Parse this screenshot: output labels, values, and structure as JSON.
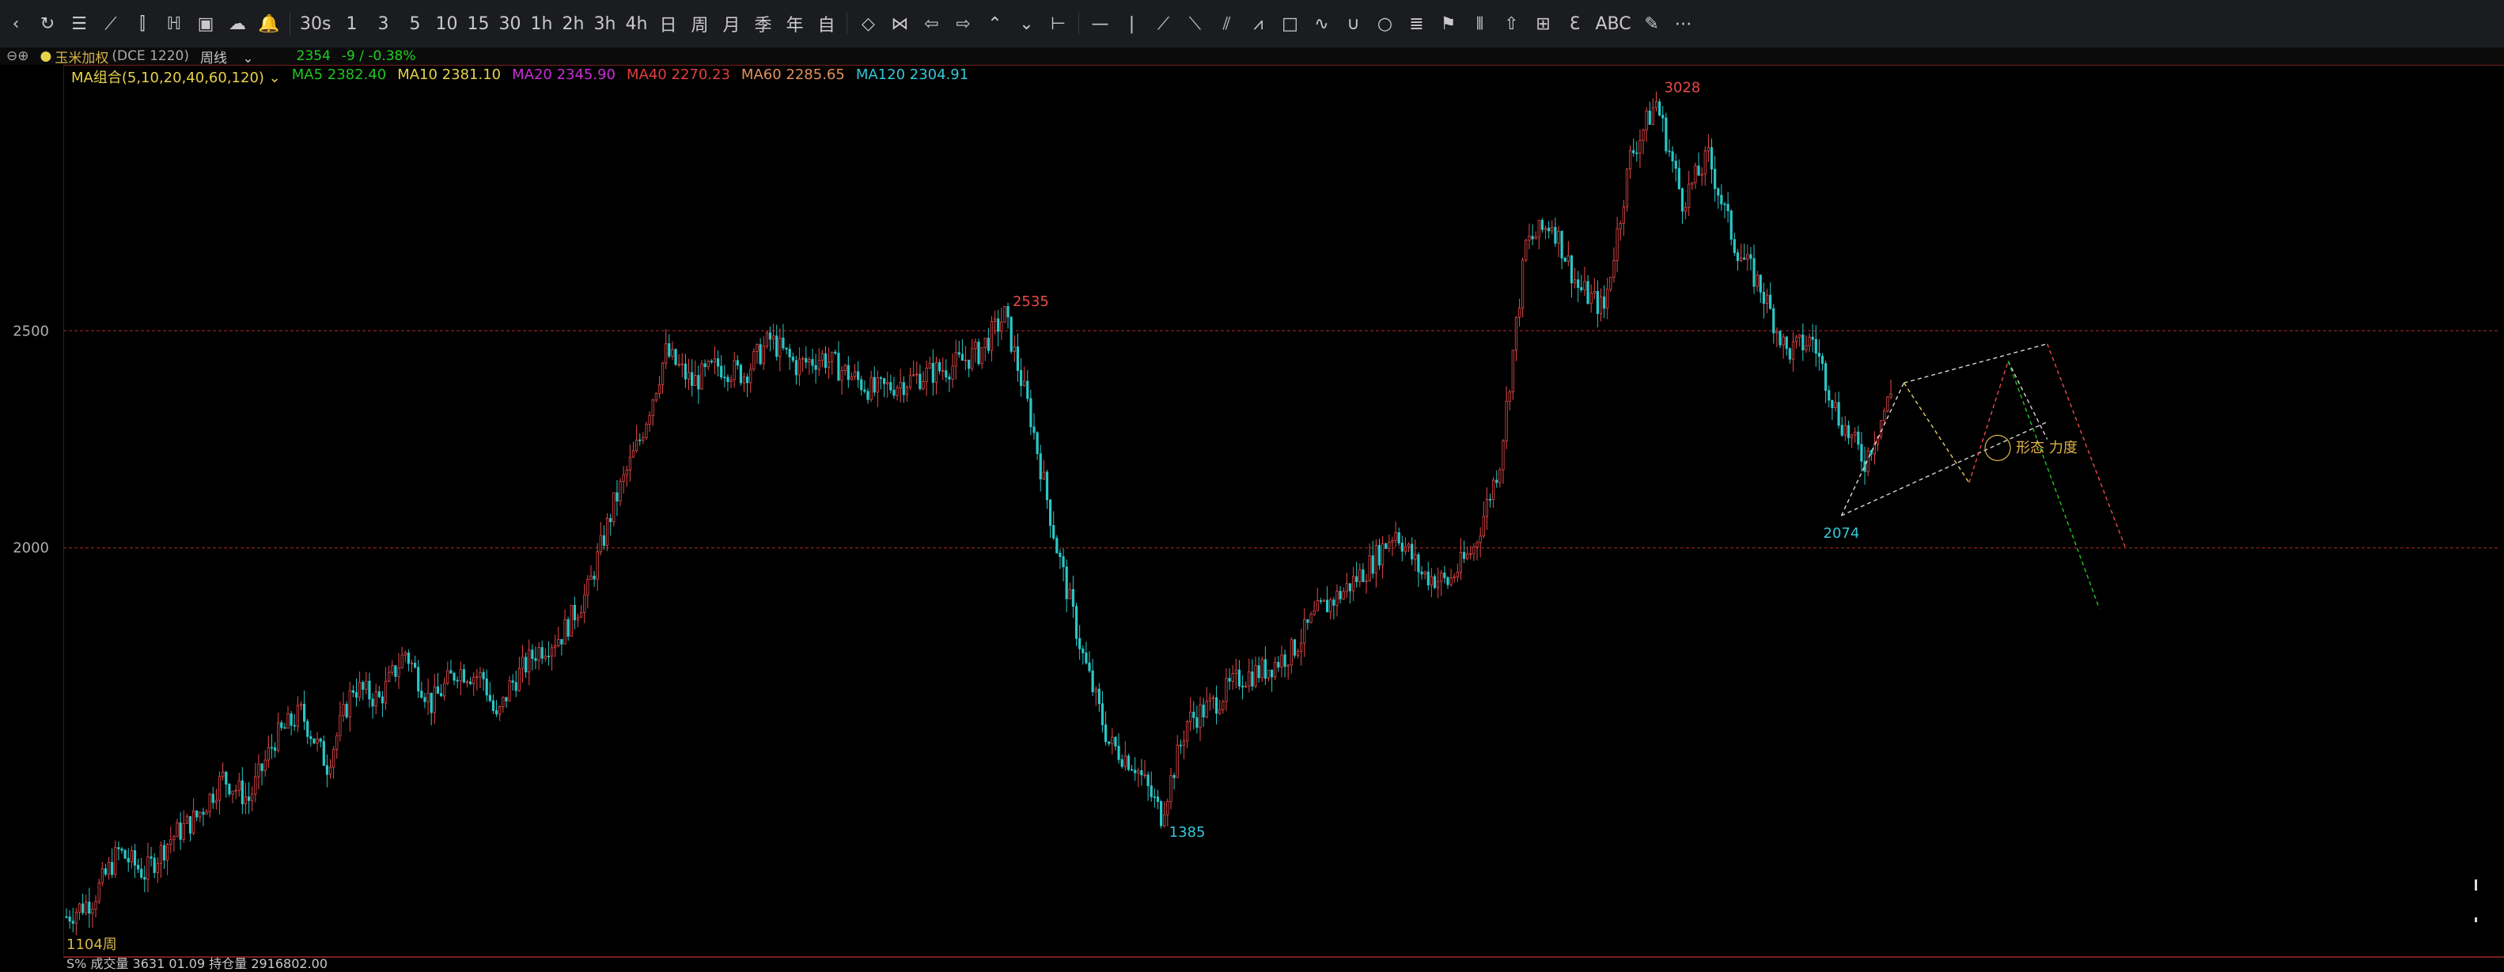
{
  "toolbar": {
    "items": [
      {
        "name": "back-icon",
        "label": "‹"
      },
      {
        "name": "refresh-icon",
        "label": "↻"
      },
      {
        "name": "list-icon",
        "label": "☰"
      },
      {
        "name": "line-chart-icon",
        "label": "⟋"
      },
      {
        "name": "candle-icon",
        "label": "⫿"
      },
      {
        "name": "bar-chart-icon",
        "label": "ℍ"
      },
      {
        "name": "monitor-icon",
        "label": "▣"
      },
      {
        "name": "cloud-icon",
        "label": "☁"
      },
      {
        "name": "bell-icon",
        "label": "🔔"
      },
      {
        "name": "period-30s",
        "label": "30s"
      },
      {
        "name": "period-1",
        "label": "1"
      },
      {
        "name": "period-3",
        "label": "3"
      },
      {
        "name": "period-5",
        "label": "5"
      },
      {
        "name": "period-10",
        "label": "10"
      },
      {
        "name": "period-15",
        "label": "15"
      },
      {
        "name": "period-30",
        "label": "30"
      },
      {
        "name": "period-1h",
        "label": "1h"
      },
      {
        "name": "period-2h",
        "label": "2h"
      },
      {
        "name": "period-3h",
        "label": "3h"
      },
      {
        "name": "period-4h",
        "label": "4h"
      },
      {
        "name": "period-day",
        "label": "日"
      },
      {
        "name": "period-week",
        "label": "周"
      },
      {
        "name": "period-month",
        "label": "月"
      },
      {
        "name": "period-quarter",
        "label": "季"
      },
      {
        "name": "period-year",
        "label": "年"
      },
      {
        "name": "period-custom",
        "label": "自"
      },
      {
        "name": "diamond-icon",
        "label": "◇"
      },
      {
        "name": "bowtie-icon",
        "label": "⋈"
      },
      {
        "name": "arrow-left-icon",
        "label": "⇦"
      },
      {
        "name": "arrow-right-icon",
        "label": "⇨"
      },
      {
        "name": "chevron-up-icon",
        "label": "⌃"
      },
      {
        "name": "chevron-down-icon",
        "label": "⌄"
      },
      {
        "name": "crosshair-icon",
        "label": "⊢"
      },
      {
        "name": "hline-icon",
        "label": "—"
      },
      {
        "name": "vline-icon",
        "label": "|"
      },
      {
        "name": "trendline-icon",
        "label": "⟋"
      },
      {
        "name": "ray-icon",
        "label": "⟍"
      },
      {
        "name": "parallel-icon",
        "label": "⫽"
      },
      {
        "name": "polyline-icon",
        "label": "⩘"
      },
      {
        "name": "rectangle-icon",
        "label": "□"
      },
      {
        "name": "wave-icon",
        "label": "∿"
      },
      {
        "name": "arc-icon",
        "label": "∪"
      },
      {
        "name": "circle-icon",
        "label": "○"
      },
      {
        "name": "fib-icon",
        "label": "≣"
      },
      {
        "name": "flag-icon",
        "label": "⚑"
      },
      {
        "name": "gann-icon",
        "label": "⦀"
      },
      {
        "name": "up-arrow-icon",
        "label": "⇧"
      },
      {
        "name": "measure-icon",
        "label": "⊞"
      },
      {
        "name": "price-range-icon",
        "label": "Ɛ"
      },
      {
        "name": "text-icon",
        "label": "ABC"
      },
      {
        "name": "brush-icon",
        "label": "✎"
      },
      {
        "name": "more-icon",
        "label": "⋯"
      }
    ]
  },
  "info": {
    "symbol": "玉米加权",
    "exchange": "(DCE 1220)",
    "period": "周线",
    "price": "2354",
    "change": "-9 / -0.38%"
  },
  "ma": {
    "combo": "MA组合(5,10,20,40,60,120)",
    "items": [
      {
        "label": "MA5 2382.40",
        "color": "#21c521"
      },
      {
        "label": "MA10 2381.10",
        "color": "#e6d24a"
      },
      {
        "label": "MA20 2345.90",
        "color": "#c92fd6"
      },
      {
        "label": "MA40 2270.23",
        "color": "#e04040"
      },
      {
        "label": "MA60 2285.65",
        "color": "#e2905a"
      },
      {
        "label": "MA120 2304.91",
        "color": "#33c8d6"
      }
    ]
  },
  "chart_data": {
    "type": "candlestick",
    "y_ticks": [
      2500,
      2000
    ],
    "ylim": [
      1130,
      3080
    ],
    "gridlines": [
      2500,
      2000
    ],
    "series": [
      {
        "x": [
          0,
          10,
          20,
          30,
          40,
          50,
          60,
          70,
          80,
          90,
          100,
          110,
          120,
          130,
          140,
          150,
          160,
          165,
          170,
          180,
          190,
          200,
          210,
          220,
          230,
          240,
          250,
          260,
          270,
          280,
          290,
          300,
          310,
          320,
          330,
          340,
          350,
          360,
          370,
          380,
          390,
          400,
          410,
          420,
          430,
          440,
          450,
          460,
          470,
          480,
          490,
          500,
          510,
          520,
          530,
          540,
          550,
          560,
          570,
          580,
          590,
          600,
          610,
          620,
          630,
          640,
          650,
          660,
          670,
          680,
          690,
          700
        ],
        "y": [
          1150,
          1190,
          1300,
          1250,
          1330,
          1380,
          1470,
          1420,
          1560,
          1620,
          1500,
          1680,
          1650,
          1760,
          1640,
          1720,
          1700,
          1600,
          1680,
          1760,
          1800,
          1900,
          2100,
          2250,
          2450,
          2380,
          2420,
          2400,
          2480,
          2420,
          2440,
          2400,
          2360,
          2380,
          2400,
          2420,
          2450,
          2535,
          2300,
          2000,
          1750,
          1550,
          1500,
          1385,
          1600,
          1640,
          1700,
          1720,
          1760,
          1850,
          1900,
          1960,
          2040,
          1940,
          1920,
          2000,
          2200,
          2700,
          2750,
          2600,
          2550,
          2900,
          3028,
          2800,
          2900,
          2700,
          2600,
          2450,
          2480,
          2300,
          2200,
          2354
        ]
      }
    ],
    "peaks": [
      {
        "label": "2535",
        "value": 2535,
        "color": "#e84a4a"
      },
      {
        "label": "1385",
        "value": 1385,
        "color": "#33c8d6"
      },
      {
        "label": "3028",
        "value": 3028,
        "color": "#e84a4a"
      },
      {
        "label": "2074",
        "value": 2074,
        "color": "#33c8d6"
      }
    ],
    "annotation": "形态  力度"
  },
  "footer": {
    "bars_label": "1104周",
    "volume_label": "S% 成交量 3631 01.09   持仓量 2916802.00"
  },
  "colors": {
    "up": "#e84a4a",
    "down": "#2bc7c7",
    "grid": "#7a1e1e"
  }
}
